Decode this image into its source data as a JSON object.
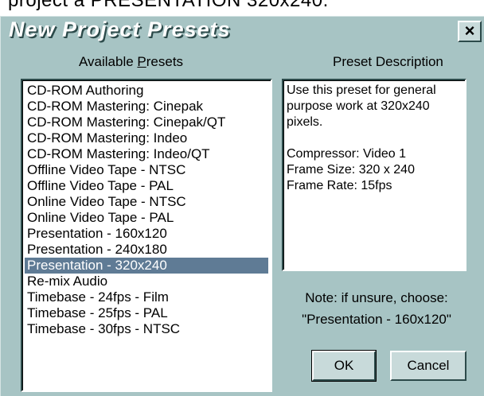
{
  "above_caption": "project a PRESENTATION 320x240.",
  "dialog": {
    "title": "New Project Presets",
    "close_label": "×"
  },
  "presets_panel": {
    "label_before": "Available ",
    "label_accel": "P",
    "label_after": "resets",
    "selected_index": 11,
    "items": [
      "CD-ROM Authoring",
      "CD-ROM Mastering: Cinepak",
      "CD-ROM Mastering: Cinepak/QT",
      "CD-ROM Mastering: Indeo",
      "CD-ROM Mastering: Indeo/QT",
      "Offline Video Tape - NTSC",
      "Offline Video Tape - PAL",
      "Online Video Tape - NTSC",
      "Online Video Tape - PAL",
      "Presentation - 160x120",
      "Presentation - 240x180",
      "Presentation - 320x240",
      "Re-mix Audio",
      "Timebase - 24fps - Film",
      "Timebase - 25fps - PAL",
      "Timebase - 30fps - NTSC"
    ]
  },
  "description_panel": {
    "label": "Preset Description",
    "lines": [
      "Use this preset for general",
      "purpose work at 320x240",
      "pixels.",
      "",
      "Compressor: Video 1",
      "Frame Size: 320 x 240",
      "Frame Rate: 15fps"
    ]
  },
  "note": {
    "line1": "Note: if unsure, choose:",
    "line2": "\"Presentation - 160x120\""
  },
  "buttons": {
    "ok": "OK",
    "cancel": "Cancel"
  },
  "colors": {
    "dialog_bg": "#a7c4c4",
    "selection_bg": "#5f7b95",
    "title_text": "#ffffff"
  }
}
